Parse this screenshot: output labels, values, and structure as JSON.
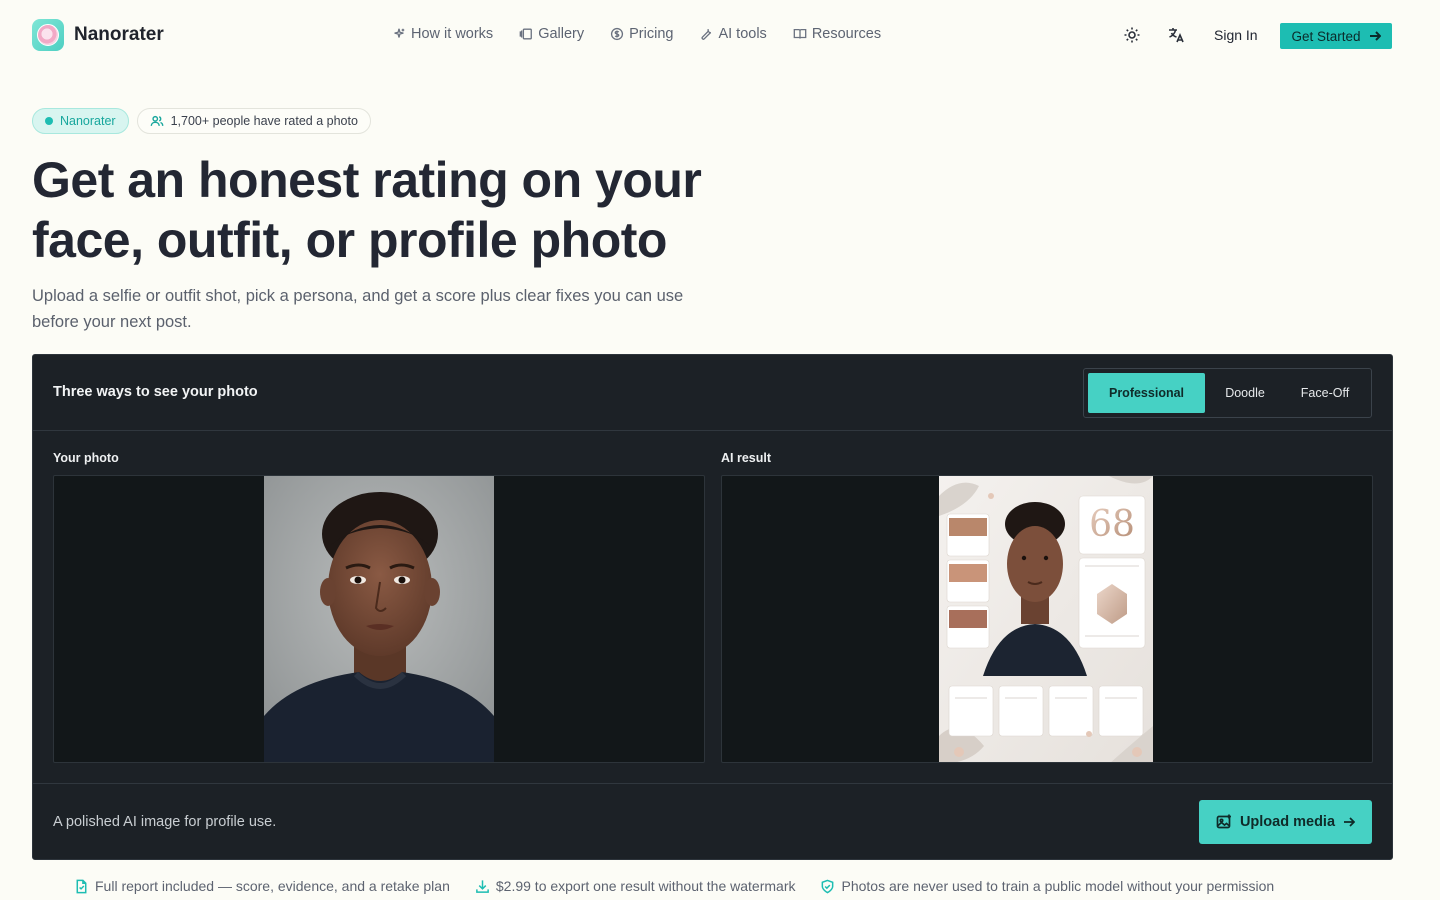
{
  "header": {
    "brand": "Nanorater",
    "nav": [
      {
        "label": "How it works",
        "icon": "sparkles-icon"
      },
      {
        "label": "Gallery",
        "icon": "gallery-icon"
      },
      {
        "label": "Pricing",
        "icon": "dollar-icon"
      },
      {
        "label": "AI tools",
        "icon": "wrench-icon"
      },
      {
        "label": "Resources",
        "icon": "book-icon"
      }
    ],
    "sign_in": "Sign In",
    "cta": "Get Started"
  },
  "hero": {
    "badge_brand": "Nanorater",
    "badge_count": "1,700+ people have rated a photo",
    "headline": "Get an honest rating on your face, outfit, or profile photo",
    "subline": "Upload a selfie or outfit shot, pick a persona, and get a score plus clear fixes you can use before your next post."
  },
  "demo": {
    "title": "Three ways to see your photo",
    "modes": [
      "Professional",
      "Doodle",
      "Face-Off"
    ],
    "active_mode": "Professional",
    "left_label": "Your photo",
    "right_label": "AI result",
    "result_score": "68",
    "footer_text": "A polished AI image for profile use.",
    "upload_label": "Upload media"
  },
  "features": [
    {
      "label": "Full report included — score, evidence, and a retake plan",
      "icon": "report-icon"
    },
    {
      "label": "$2.99 to export one result without the watermark",
      "icon": "download-icon"
    },
    {
      "label": "Photos are never used to train a public model without your permission",
      "icon": "shield-check-icon"
    }
  ],
  "colors": {
    "accent": "#1dbdb2",
    "accent_light": "#46d1c4",
    "panel": "#1c2126",
    "background": "#fcfcf6"
  }
}
